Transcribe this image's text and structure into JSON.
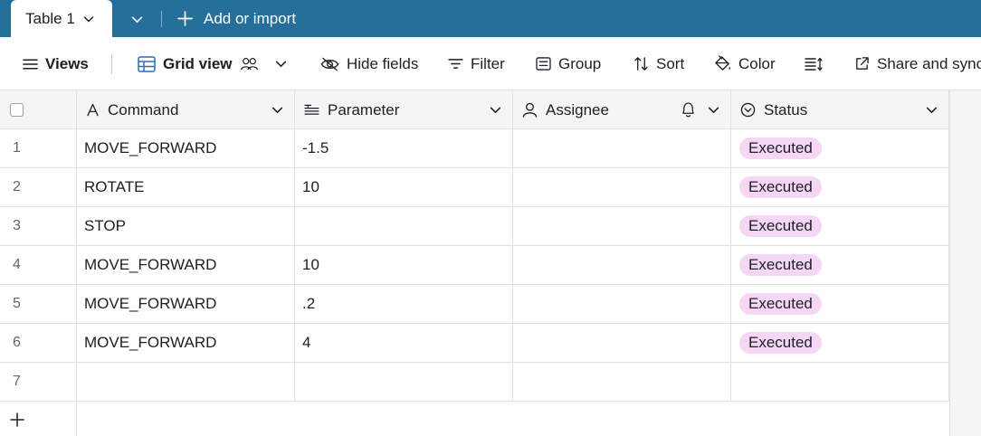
{
  "tabs": {
    "active_label": "Table 1",
    "add_import_label": "Add or import"
  },
  "toolbar": {
    "views_label": "Views",
    "grid_view_label": "Grid view",
    "hide_fields_label": "Hide fields",
    "filter_label": "Filter",
    "group_label": "Group",
    "sort_label": "Sort",
    "color_label": "Color",
    "share_label": "Share and sync"
  },
  "columns": [
    {
      "label": "Command",
      "icon": "text-icon"
    },
    {
      "label": "Parameter",
      "icon": "long-text-icon"
    },
    {
      "label": "Assignee",
      "icon": "user-icon"
    },
    {
      "label": "Status",
      "icon": "status-icon"
    }
  ],
  "rows": [
    {
      "num": "1",
      "command": "MOVE_FORWARD",
      "parameter": "-1.5",
      "assignee": "",
      "status": "Executed"
    },
    {
      "num": "2",
      "command": "ROTATE",
      "parameter": "10",
      "assignee": "",
      "status": "Executed"
    },
    {
      "num": "3",
      "command": "STOP",
      "parameter": "",
      "assignee": "",
      "status": "Executed"
    },
    {
      "num": "4",
      "command": "MOVE_FORWARD",
      "parameter": "10",
      "assignee": "",
      "status": "Executed"
    },
    {
      "num": "5",
      "command": "MOVE_FORWARD",
      "parameter": ".2",
      "assignee": "",
      "status": "Executed"
    },
    {
      "num": "6",
      "command": "MOVE_FORWARD",
      "parameter": "4",
      "assignee": "",
      "status": "Executed"
    },
    {
      "num": "7",
      "command": "",
      "parameter": "",
      "assignee": "",
      "status": ""
    }
  ],
  "colors": {
    "tabbar": "#266f9a",
    "status_pill": "#f6d6f5"
  }
}
